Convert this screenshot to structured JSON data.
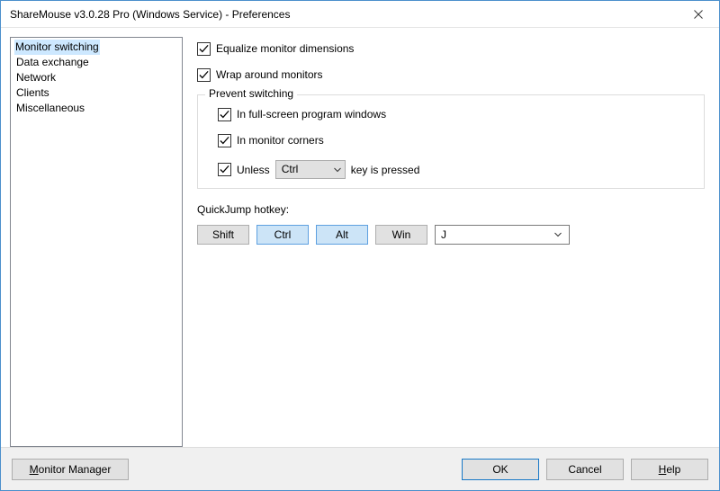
{
  "window": {
    "title": "ShareMouse v3.0.28 Pro (Windows Service) - Preferences"
  },
  "sidebar": {
    "items": [
      {
        "label": "Monitor switching",
        "selected": true
      },
      {
        "label": "Data exchange",
        "selected": false
      },
      {
        "label": "Network",
        "selected": false
      },
      {
        "label": "Clients",
        "selected": false
      },
      {
        "label": "Miscellaneous",
        "selected": false
      }
    ]
  },
  "options": {
    "equalize_label": "Equalize monitor dimensions",
    "equalize_checked": true,
    "wrap_label": "Wrap around monitors",
    "wrap_checked": true
  },
  "prevent": {
    "group_title": "Prevent switching",
    "fullscreen_label": "In full-screen program windows",
    "fullscreen_checked": true,
    "corners_label": "In monitor corners",
    "corners_checked": true,
    "unless_checked": true,
    "unless_prefix": "Unless",
    "unless_key": "Ctrl",
    "unless_suffix": "key is pressed"
  },
  "quickjump": {
    "label": "QuickJump hotkey:",
    "modifiers": [
      {
        "label": "Shift",
        "active": false
      },
      {
        "label": "Ctrl",
        "active": true
      },
      {
        "label": "Alt",
        "active": true
      },
      {
        "label": "Win",
        "active": false
      }
    ],
    "key": "J"
  },
  "footer": {
    "monitor_manager": "Monitor Manager",
    "ok": "OK",
    "cancel": "Cancel",
    "help": "Help"
  }
}
